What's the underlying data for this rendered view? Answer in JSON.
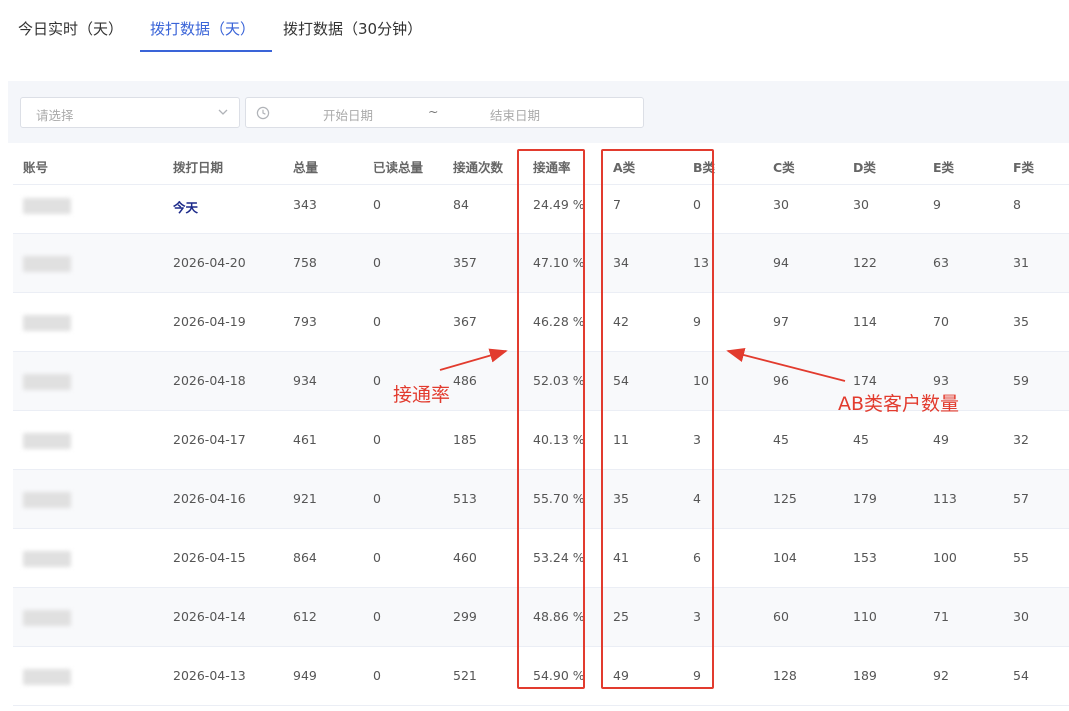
{
  "tabs": [
    {
      "label": "今日实时（天）"
    },
    {
      "label": "拨打数据（天）"
    },
    {
      "label": "拨打数据（30分钟）"
    }
  ],
  "filters": {
    "select_placeholder": "请选择",
    "start_date_placeholder": "开始日期",
    "separator": "~",
    "end_date_placeholder": "结束日期"
  },
  "table": {
    "headers": [
      "账号",
      "拨打日期",
      "总量",
      "已读总量",
      "接通次数",
      "接通率",
      "A类",
      "B类",
      "C类",
      "D类",
      "E类",
      "F类"
    ],
    "rows": [
      {
        "date": "今天",
        "total": "343",
        "read": "0",
        "connected": "84",
        "rate": "24.49 %",
        "a": "7",
        "b": "0",
        "c": "30",
        "d": "30",
        "e": "9",
        "f": "8"
      },
      {
        "date": "2026-04-20",
        "total": "758",
        "read": "0",
        "connected": "357",
        "rate": "47.10 %",
        "a": "34",
        "b": "13",
        "c": "94",
        "d": "122",
        "e": "63",
        "f": "31"
      },
      {
        "date": "2026-04-19",
        "total": "793",
        "read": "0",
        "connected": "367",
        "rate": "46.28 %",
        "a": "42",
        "b": "9",
        "c": "97",
        "d": "114",
        "e": "70",
        "f": "35"
      },
      {
        "date": "2026-04-18",
        "total": "934",
        "read": "0",
        "connected": "486",
        "rate": "52.03 %",
        "a": "54",
        "b": "10",
        "c": "96",
        "d": "174",
        "e": "93",
        "f": "59"
      },
      {
        "date": "2026-04-17",
        "total": "461",
        "read": "0",
        "connected": "185",
        "rate": "40.13 %",
        "a": "11",
        "b": "3",
        "c": "45",
        "d": "45",
        "e": "49",
        "f": "32"
      },
      {
        "date": "2026-04-16",
        "total": "921",
        "read": "0",
        "connected": "513",
        "rate": "55.70 %",
        "a": "35",
        "b": "4",
        "c": "125",
        "d": "179",
        "e": "113",
        "f": "57"
      },
      {
        "date": "2026-04-15",
        "total": "864",
        "read": "0",
        "connected": "460",
        "rate": "53.24 %",
        "a": "41",
        "b": "6",
        "c": "104",
        "d": "153",
        "e": "100",
        "f": "55"
      },
      {
        "date": "2026-04-14",
        "total": "612",
        "read": "0",
        "connected": "299",
        "rate": "48.86 %",
        "a": "25",
        "b": "3",
        "c": "60",
        "d": "110",
        "e": "71",
        "f": "30"
      },
      {
        "date": "2026-04-13",
        "total": "949",
        "read": "0",
        "connected": "521",
        "rate": "54.90 %",
        "a": "49",
        "b": "9",
        "c": "128",
        "d": "189",
        "e": "92",
        "f": "54"
      }
    ]
  },
  "annotations": {
    "rate_label": "接通率",
    "ab_label": "AB类客户数量",
    "color": "#e23b2e"
  },
  "colors": {
    "accent": "#3a64d8",
    "today_text": "#1c2a8a"
  }
}
